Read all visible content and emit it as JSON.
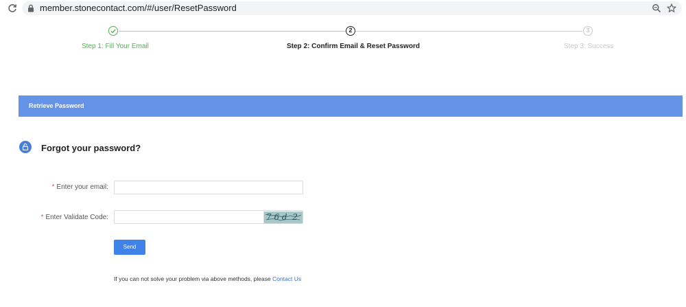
{
  "browser": {
    "url": "member.stonecontact.com/#/user/ResetPassword",
    "icons": [
      "reload-icon",
      "lock-icon",
      "zoom-icon",
      "star-icon"
    ]
  },
  "stepper": {
    "steps": [
      {
        "number": "",
        "label": "Step 1: Fill Your Email",
        "state": "done",
        "icon": "check-icon"
      },
      {
        "number": "2",
        "label": "Step 2: Confirm Email & Reset Password",
        "state": "active"
      },
      {
        "number": "3",
        "label": "Step 3: Success",
        "state": "pending"
      }
    ]
  },
  "panel": {
    "title": "Retrieve Password"
  },
  "form": {
    "heading": "Forgot your password?",
    "heading_icon": "unlock-icon",
    "required_mark": "*",
    "email_label": "Enter your email:",
    "email_value": "",
    "code_label": "Enter Validate Code:",
    "code_value": "",
    "captcha_text": "7 6 d  2",
    "send_label": "Send"
  },
  "help": {
    "text": "If you can not solve your problem via above methods, please ",
    "link": "Contact Us"
  },
  "colors": {
    "accent": "#6493e8",
    "done": "#52b152",
    "button": "#3f82e8",
    "pending": "#c9c9c9"
  }
}
